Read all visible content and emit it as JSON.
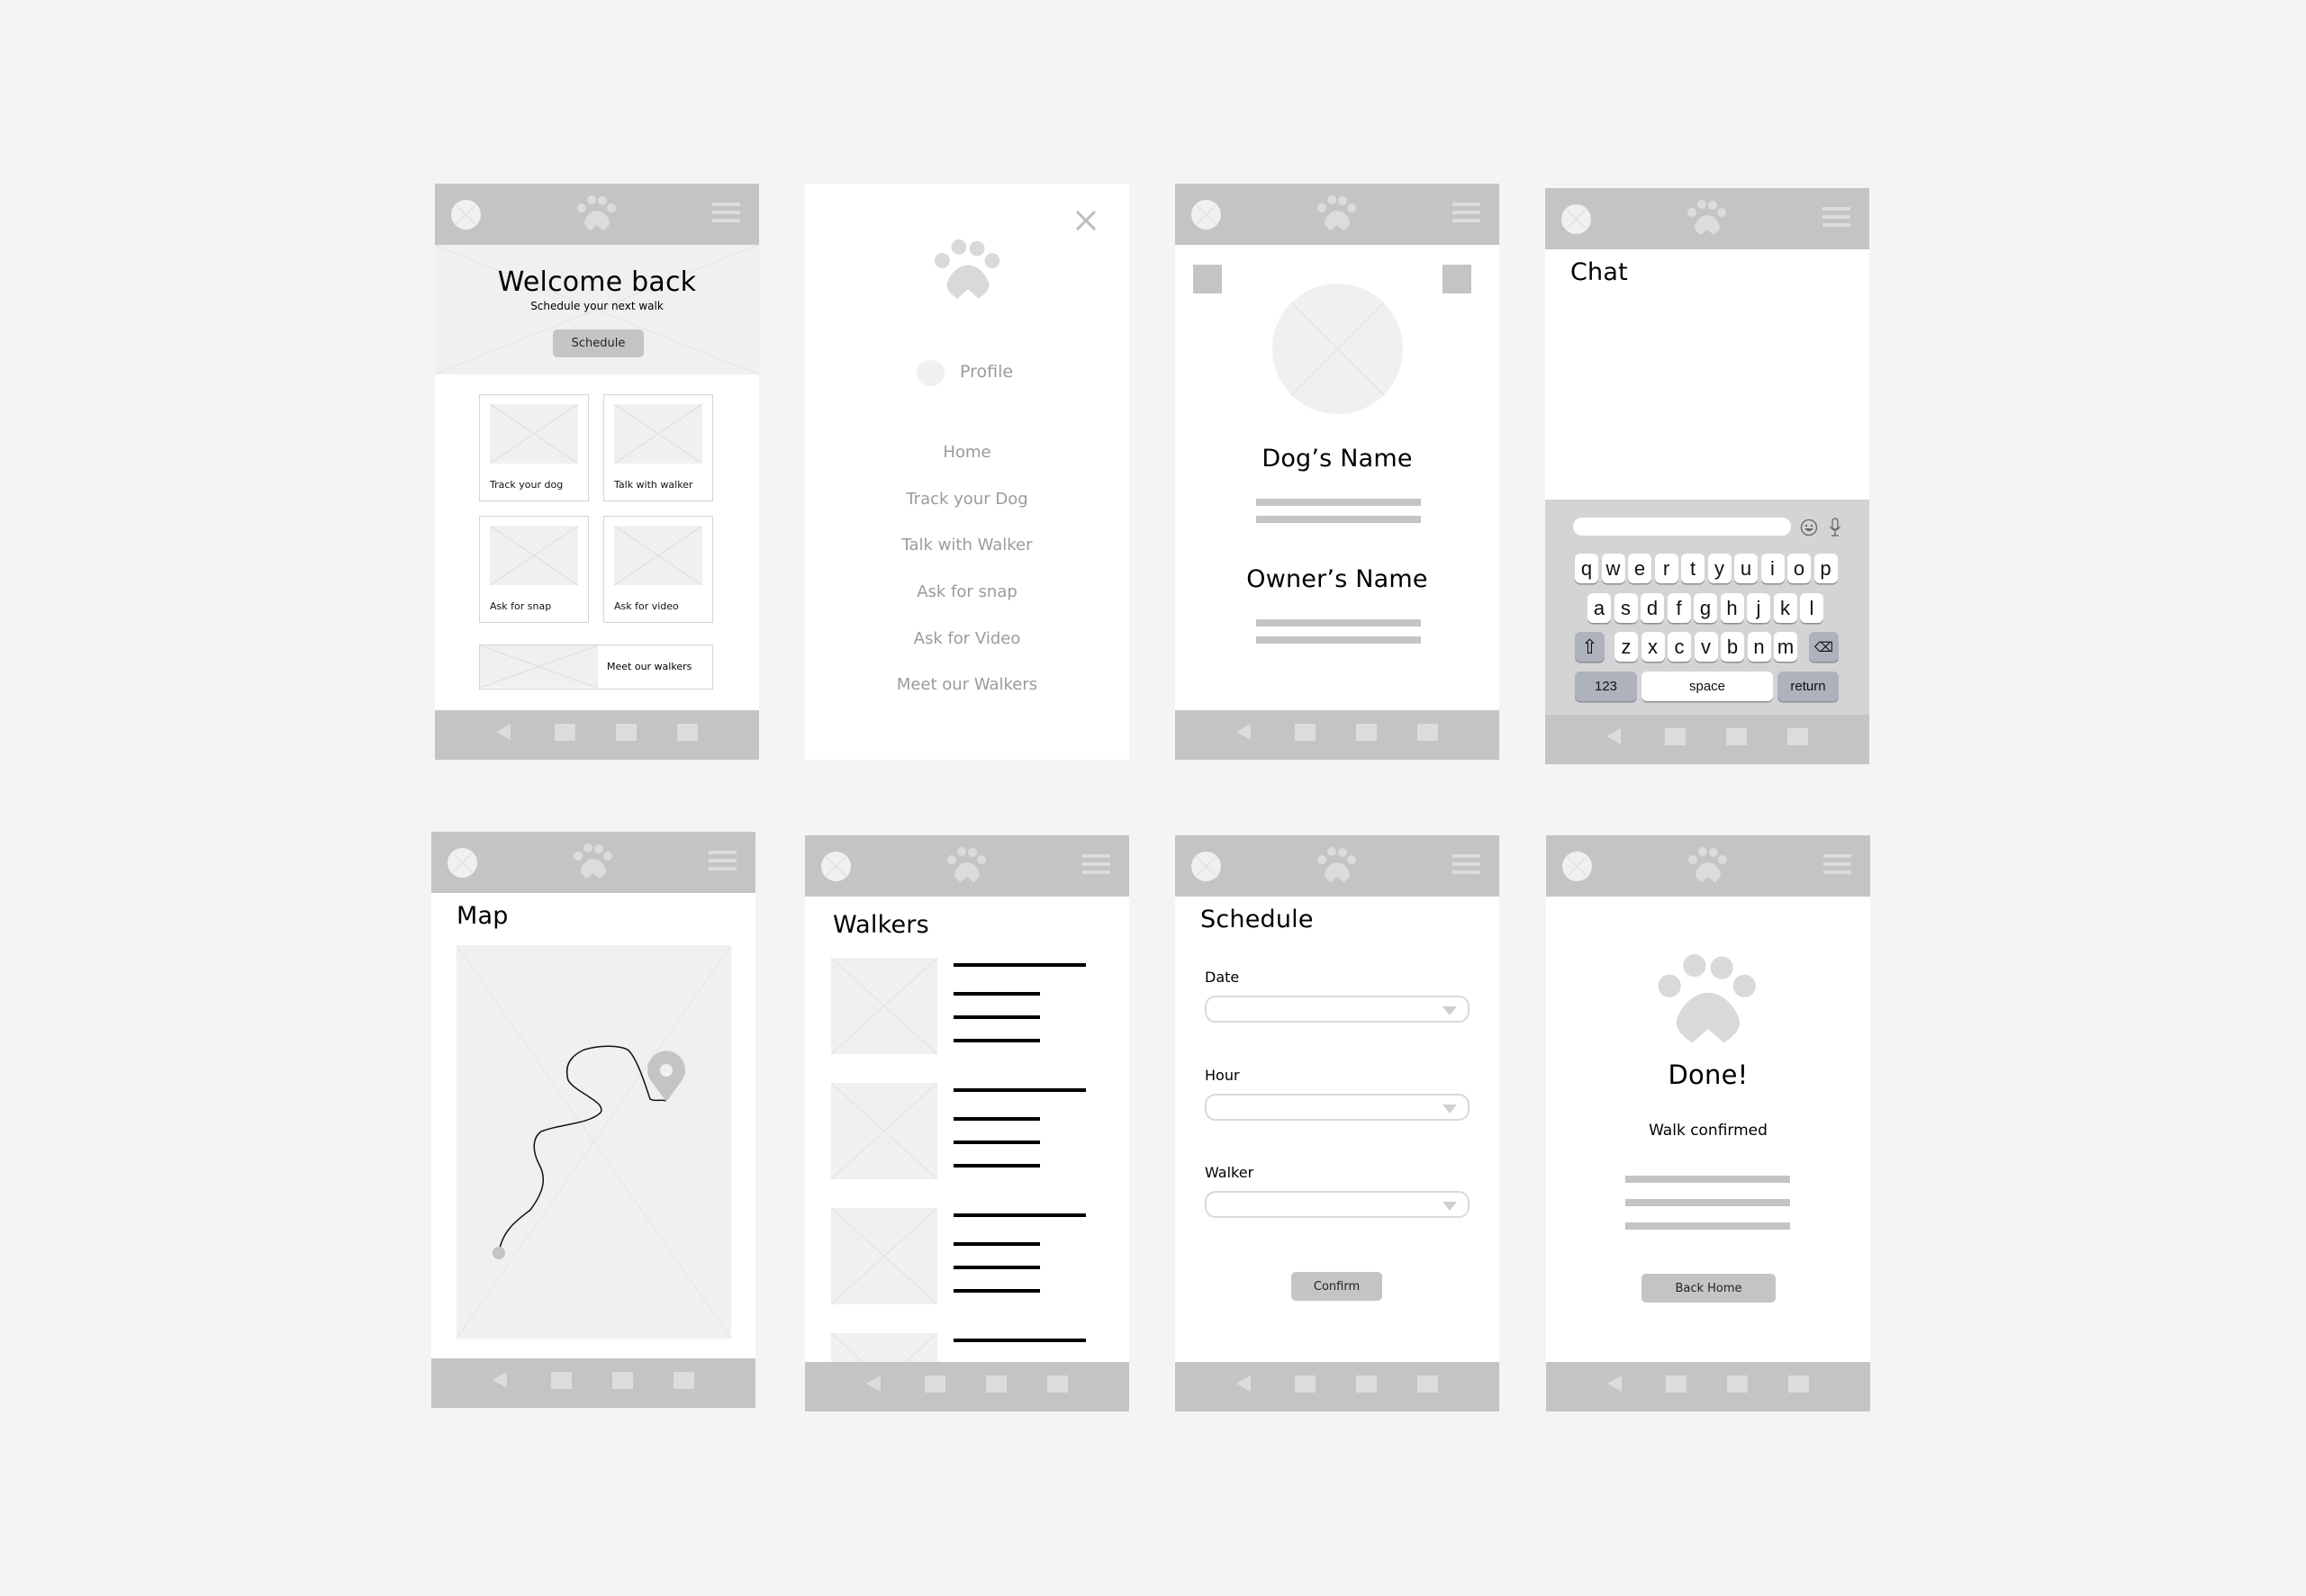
{
  "colors": {
    "background": "#f4f4f4",
    "bar": "#c4c4c4",
    "placeholder": "#f1efef",
    "icon_light": "#dcdcdc",
    "menu_text": "#9b9b9b",
    "keyboard": "#d4d4d6",
    "key_special": "#adb2bd"
  },
  "common": {
    "logo_icon": "paw-icon",
    "avatar_icon": "avatar-placeholder-icon",
    "menu_icon": "hamburger-menu-icon",
    "nav": [
      "back-icon",
      "nav-square-icon",
      "nav-square-icon",
      "nav-square-icon"
    ]
  },
  "home": {
    "heading": "Welcome back",
    "subheading": "Schedule your next walk",
    "schedule_button": "Schedule",
    "cards": [
      {
        "label": "Track your dog"
      },
      {
        "label": "Talk with walker"
      },
      {
        "label": "Ask for snap"
      },
      {
        "label": "Ask for video"
      }
    ],
    "banner_label": "Meet our walkers"
  },
  "menu": {
    "close_icon": "close-icon",
    "profile_label": "Profile",
    "items": [
      "Home",
      "Track your Dog",
      "Talk with Walker",
      "Ask for snap",
      "Ask for Video",
      "Meet our Walkers"
    ]
  },
  "profile": {
    "dog_name": "Dog’s Name",
    "owner_name": "Owner’s Name"
  },
  "chat": {
    "title": "Chat",
    "input_value": "",
    "keyboard": {
      "row1": [
        "q",
        "w",
        "e",
        "r",
        "t",
        "y",
        "u",
        "i",
        "o",
        "p"
      ],
      "row2": [
        "a",
        "s",
        "d",
        "f",
        "g",
        "h",
        "j",
        "k",
        "l"
      ],
      "row3": [
        "z",
        "x",
        "c",
        "v",
        "b",
        "n",
        "m"
      ],
      "shift": "⇧",
      "backspace": "⌫",
      "numbers": "123",
      "space": "space",
      "return": "return"
    }
  },
  "map": {
    "title": "Map"
  },
  "walkers": {
    "title": "Walkers",
    "count_visible": 4
  },
  "schedule": {
    "title": "Schedule",
    "fields": [
      {
        "label": "Date",
        "value": ""
      },
      {
        "label": "Hour",
        "value": ""
      },
      {
        "label": "Walker",
        "value": ""
      }
    ],
    "confirm_button": "Confirm"
  },
  "done": {
    "title": "Done!",
    "message": "Walk confirmed",
    "back_button": "Back Home"
  }
}
